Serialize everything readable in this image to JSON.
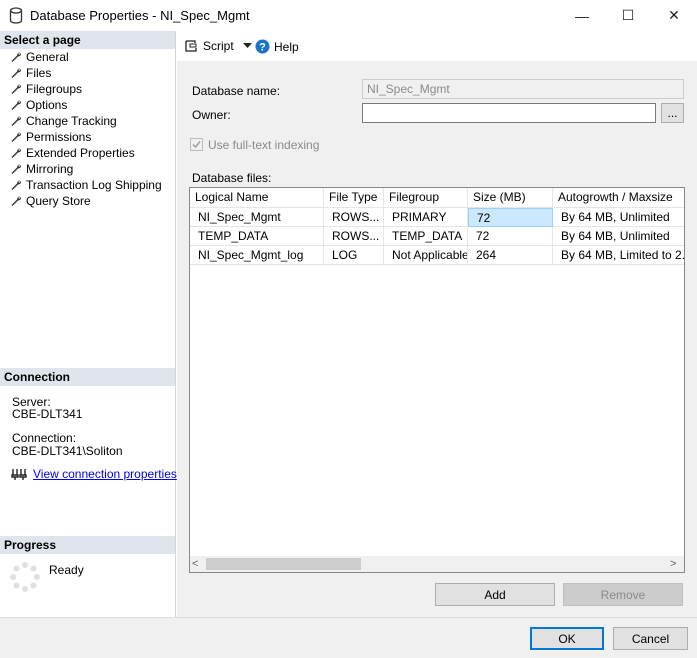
{
  "window": {
    "title": "Database Properties - NI_Spec_Mgmt",
    "minimize": "—",
    "maximize": "☐",
    "close": "✕"
  },
  "left": {
    "select_page_header": "Select a page",
    "pages": [
      {
        "label": "General"
      },
      {
        "label": "Files"
      },
      {
        "label": "Filegroups"
      },
      {
        "label": "Options"
      },
      {
        "label": "Change Tracking"
      },
      {
        "label": "Permissions"
      },
      {
        "label": "Extended Properties"
      },
      {
        "label": "Mirroring"
      },
      {
        "label": "Transaction Log Shipping"
      },
      {
        "label": "Query Store"
      }
    ],
    "connection_header": "Connection",
    "server_label": "Server:",
    "server_value": "CBE-DLT341",
    "connection_label": "Connection:",
    "connection_value": "CBE-DLT341\\Soliton",
    "view_connection_link": "View connection properties",
    "progress_header": "Progress",
    "progress_status": "Ready"
  },
  "toolbar": {
    "script_label": "Script",
    "help_label": "Help"
  },
  "form": {
    "db_name_label": "Database name:",
    "db_name_value": "NI_Spec_Mgmt",
    "owner_label": "Owner:",
    "owner_value": "",
    "browse_label": "...",
    "fulltext_label": "Use full-text indexing",
    "db_files_label": "Database files:"
  },
  "grid": {
    "headers": [
      "Logical Name",
      "File Type",
      "Filegroup",
      "Size (MB)",
      "Autogrowth / Maxsize"
    ],
    "rows": [
      [
        "NI_Spec_Mgmt",
        "ROWS...",
        "PRIMARY",
        "72",
        "By 64 MB, Unlimited"
      ],
      [
        "TEMP_DATA",
        "ROWS...",
        "TEMP_DATA",
        "72",
        "By 64 MB, Unlimited"
      ],
      [
        "NI_Spec_Mgmt_log",
        "LOG",
        "Not Applicable",
        "264",
        "By 64 MB, Limited to 2..."
      ]
    ],
    "scroll_left": "<",
    "scroll_right": ">"
  },
  "buttons": {
    "add": "Add",
    "remove": "Remove",
    "ok": "OK",
    "cancel": "Cancel"
  }
}
